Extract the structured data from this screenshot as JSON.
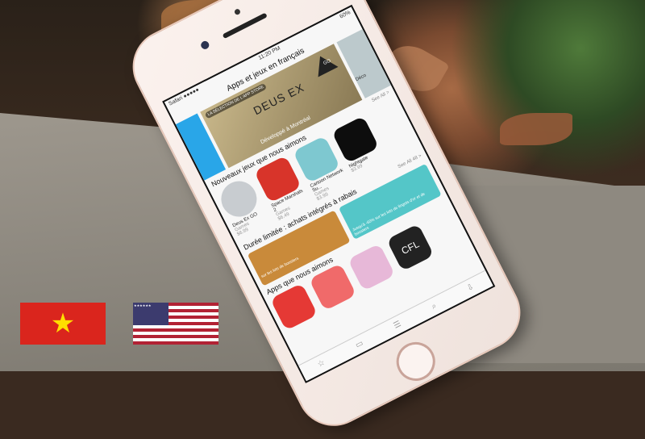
{
  "screen": {
    "status": {
      "carrier": "Safari ●●●●●",
      "time": "11:20 PM",
      "battery": "60%"
    },
    "nav_title": "Apps et jeux en français",
    "banner": {
      "badge": "LA SÉLECTION DE L'APP STORE",
      "title": "DEUS EX",
      "go": "GO",
      "subtitle": "Développé à Montréal",
      "side": "Déco"
    },
    "sections": [
      {
        "title": "Nouveaux jeux que nous aimons",
        "see_all": "See All >",
        "apps": [
          {
            "name": "Deus Ex GO",
            "category": "Games",
            "price": "$6.99",
            "color": "#c8ccd0"
          },
          {
            "name": "Space Marshals 2",
            "category": "Games",
            "price": "$6.49",
            "color": "#d8342a"
          },
          {
            "name": "Cartoon Network Su...",
            "category": "Games",
            "price": "$3.99",
            "color": "#7ec8d0"
          },
          {
            "name": "Nightgate",
            "category": "Games",
            "price": "$3.99",
            "color": "#0d0d0d"
          }
        ]
      },
      {
        "title": "Durée limitée : achats intégrés à rabais",
        "see_all": "See All 48 >",
        "promos": [
          {
            "text": "sur les lots de boosters",
            "color": "#c98a3a"
          },
          {
            "text": "Jusqu'à -60% sur les lots de lingots d'or et de boosters",
            "color": "#54c6c8"
          }
        ]
      },
      {
        "title": "Apps que nous aimons",
        "apps": [
          {
            "color": "#e53935"
          },
          {
            "color": "#f06a6a"
          },
          {
            "color": "#e7b8d8"
          },
          {
            "name": "CFL",
            "color": "#222222"
          }
        ]
      }
    ],
    "tabs": [
      "☆",
      "▭",
      "☰",
      "⌕",
      "⇩"
    ]
  },
  "flags": {
    "vietnam": "★",
    "usa": "★★★★★★"
  }
}
